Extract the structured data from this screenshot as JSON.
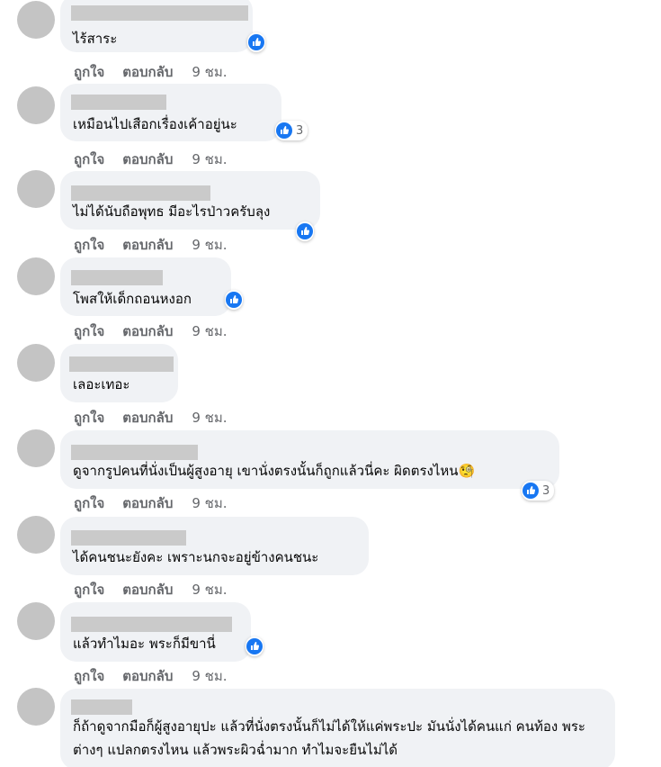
{
  "actions": {
    "like": "ถูกใจ",
    "reply": "ตอบกลับ",
    "time": "9 ชม."
  },
  "icons": {
    "like_reaction": "like-thumb-icon",
    "emoji": "face-with-monocle-icon"
  },
  "colors": {
    "like_blue": "#1877f2",
    "bubble_bg": "#f0f2f5",
    "meta_text": "#65676b"
  },
  "comments": [
    {
      "author": "",
      "text": "ไร้สาระ",
      "reactions": ""
    },
    {
      "author": "",
      "text": "เหมือนไปเสือกเรื่องเค้าอยู่นะ",
      "reactions": "3"
    },
    {
      "author": "",
      "text": "ไม่ได้นับถือพุทธ มีอะไรป่าวครับลุง",
      "reactions": ""
    },
    {
      "author": "",
      "text": "โพสให้เด็กถอนหงอก",
      "reactions": ""
    },
    {
      "author": "",
      "text": "เลอะเทอะ",
      "reactions": ""
    },
    {
      "author": "",
      "text": "ดูจากรูปคนที่นั่งเป็นผู้สูงอายุ เขานั่งตรงนั้นก็ถูกแล้วนี่คะ ผิดตรงไหน🧐",
      "reactions": "3"
    },
    {
      "author": "",
      "text": "ได้คนชนะยังคะ เพราะนกจะอยู่ข้างคนชนะ",
      "reactions": ""
    },
    {
      "author": "",
      "text": "แล้วทำไมอะ พระก็มีขานี่",
      "reactions": ""
    },
    {
      "author": "",
      "text": "ก็ถ้าดูจากมือก็ผู้สูงอายุปะ แล้วที่นั่งตรงนั้นก็ไม่ได้ให้แค่พระปะ มันนั่งได้คนแก่ คนท้อง พระ ต่างๆ แปลกตรงไหน แล้วพระผิวฉ่ำมาก ทำไมจะยืนไม่ได้",
      "reactions": ""
    }
  ]
}
